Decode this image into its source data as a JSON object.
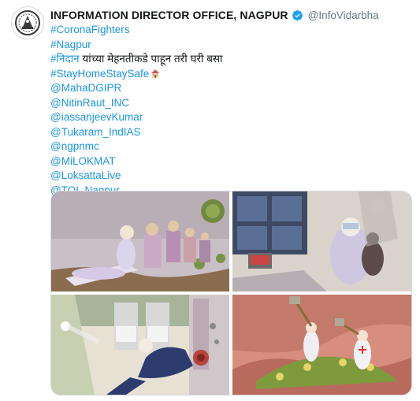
{
  "account": {
    "display_name": "INFORMATION DIRECTOR OFFICE, NAGPUR",
    "handle": "@InfoVidarbha",
    "avatar_icon": "government-emblem-icon",
    "verified_icon": "verified-badge-icon"
  },
  "tweet": {
    "hashtag_corona": "#CoronaFighters",
    "hashtag_nagpur": "#Nagpur",
    "line_nidan_tag": "#निदान",
    "line_nidan_text": " यांच्या मेहनतीकडे पाहून तरी घरी बसा",
    "hashtag_stayhome": "#StayHomeStaySafe",
    "house_emoji_icon": "house-emoji-icon",
    "mentions": [
      "@MahaDGIPR",
      "@NitinRaut_INC",
      "@iassanjeevKumar",
      "@Tukaram_IndIAS",
      "@ngpnmc",
      "@MiLOKMAT",
      "@LoksattaLive",
      "@TOI_Nagpur"
    ]
  },
  "colors": {
    "link": "#1b95e0",
    "text": "#14171a",
    "handle": "#657786",
    "verified": "#1da1f2"
  }
}
